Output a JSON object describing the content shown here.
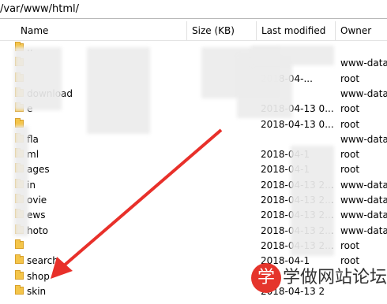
{
  "path": "/var/www/html/",
  "columns": {
    "name": "Name",
    "size": "Size (KB)",
    "modified": "Last modified",
    "owner": "Owner"
  },
  "rows": [
    {
      "name": "..",
      "modified": "",
      "owner": ""
    },
    {
      "name": "",
      "modified": "",
      "owner": "www-data"
    },
    {
      "name": "",
      "modified": "2018-04-...",
      "owner": "root"
    },
    {
      "name": "download",
      "modified": "",
      "owner": "www-data"
    },
    {
      "name": "e",
      "modified": "2018-04-13 0...",
      "owner": "root"
    },
    {
      "name": "",
      "modified": "2018-04-13 0...",
      "owner": "root"
    },
    {
      "name": "fla",
      "modified": "",
      "owner": "www-data"
    },
    {
      "name": "ml",
      "modified": "2018-04-1",
      "owner": "root"
    },
    {
      "name": "ages",
      "modified": "2018-04-1",
      "owner": "root"
    },
    {
      "name": "in",
      "modified": "2018-04-13 2...",
      "owner": "www-data"
    },
    {
      "name": "ovie",
      "modified": "2018-04-13 2...",
      "owner": "www-data"
    },
    {
      "name": "ews",
      "modified": "2018-04-13 2...",
      "owner": "www-data"
    },
    {
      "name": "hoto",
      "modified": "2018-04-13 2...",
      "owner": "www-data"
    },
    {
      "name": "",
      "modified": "2018-04-13 2...",
      "owner": "root"
    },
    {
      "name": "search",
      "modified": "2018-04-1",
      "owner": "root"
    },
    {
      "name": "shop",
      "modified": "",
      "owner": ""
    },
    {
      "name": "skin",
      "modified": "2018-04-13 2",
      "owner": ""
    }
  ],
  "watermark": {
    "badge": "学",
    "text": "学做网站论坛"
  },
  "colors": {
    "arrow": "#e8302a",
    "folder": "#f4c54a",
    "header_border": "#e0e0e0"
  }
}
